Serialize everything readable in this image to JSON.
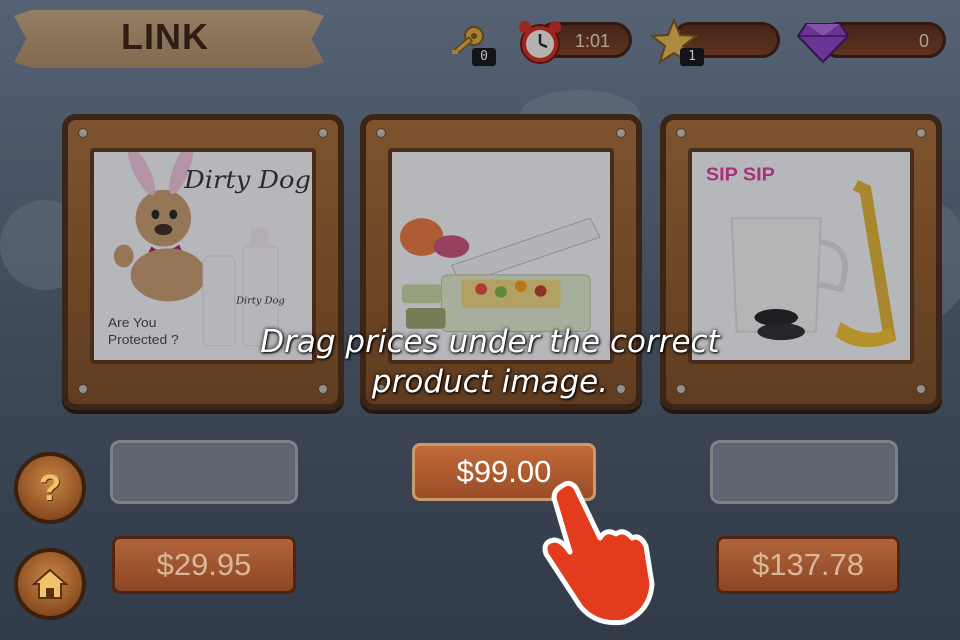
{
  "header": {
    "title": "LINK",
    "keys_count": "0",
    "timer": "1:01",
    "stars_count": "1",
    "gems_count": "0"
  },
  "products": [
    {
      "name": "dirty-dog-product",
      "brand": "Dirty Dog",
      "tagline": "Are You Protected ?"
    },
    {
      "name": "vegetable-chopper-product"
    },
    {
      "name": "sip-straw-milk-product",
      "brand": "SIP SIP"
    }
  ],
  "slots": [
    {
      "price": ""
    },
    {
      "price": "$99.00"
    },
    {
      "price": ""
    }
  ],
  "remaining_prices": [
    "$29.95",
    "$137.78"
  ],
  "instruction": "Drag prices under the correct product image.",
  "buttons": {
    "help_icon": "question-mark",
    "home_icon": "house"
  },
  "colors": {
    "wood": "#8d4624",
    "frame_border": "#4a2a12",
    "hand_pointer": "#e23b1e"
  }
}
